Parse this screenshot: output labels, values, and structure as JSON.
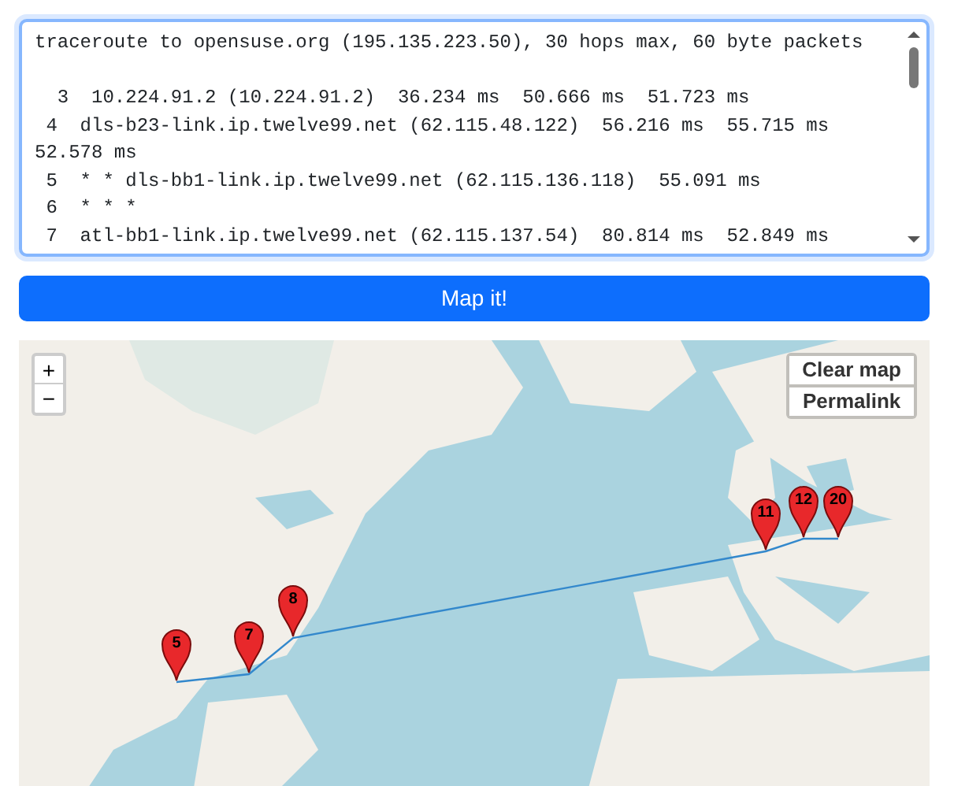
{
  "traceroute_output": {
    "header": "traceroute to opensuse.org (195.135.223.50), 30 hops max, 60 byte packets",
    "lines": [
      "  3  10.224.91.2 (10.224.91.2)  36.234 ms  50.666 ms  51.723 ms",
      " 4  dls-b23-link.ip.twelve99.net (62.115.48.122)  56.216 ms  55.715 ms 52.578 ms",
      " 5  * * dls-bb1-link.ip.twelve99.net (62.115.136.118)  55.091 ms",
      " 6  * * *",
      " 7  atl-bb1-link.ip.twelve99.net (62.115.137.54)  80.814 ms  52.849 ms"
    ]
  },
  "map_button": {
    "label": "Map it!"
  },
  "map": {
    "zoom_in": "+",
    "zoom_out": "−",
    "buttons": [
      "Clear map",
      "Permalink"
    ],
    "markers": [
      {
        "label": "5"
      },
      {
        "label": "7"
      },
      {
        "label": "8"
      },
      {
        "label": "11"
      },
      {
        "label": "12"
      },
      {
        "label": "20"
      }
    ]
  }
}
